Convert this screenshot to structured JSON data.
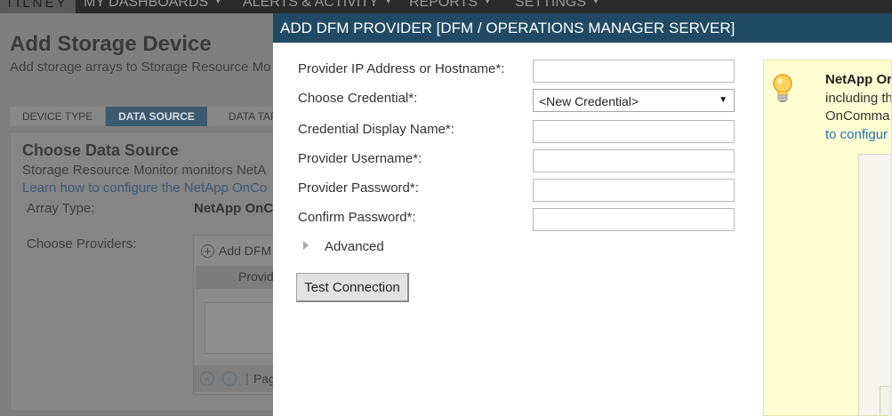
{
  "topnav": {
    "brand": "TILNEY",
    "items": [
      {
        "label": "MY DASHBOARDS"
      },
      {
        "label": "ALERTS & ACTIVITY"
      },
      {
        "label": "REPORTS"
      },
      {
        "label": "SETTINGS"
      }
    ]
  },
  "page": {
    "title": "Add Storage Device",
    "subtitle": "Add storage arrays to Storage Resource Mo",
    "steps": [
      "DEVICE TYPE",
      "DATA SOURCE",
      "DATA TARG"
    ],
    "panel": {
      "title": "Choose Data Source",
      "description": "Storage Resource Monitor monitors NetA",
      "link": "Learn how to configure the NetApp OnCo",
      "array_type_label": "Array Type:",
      "array_type_value": "NetApp OnC",
      "providers_label": "Choose Providers:",
      "add_provider": "Add DFM",
      "provider_column": "Provid",
      "pager_text": "Pag"
    }
  },
  "modal": {
    "title": "ADD DFM PROVIDER [DFM / OPERATIONS MANAGER SERVER]",
    "fields": {
      "ip_label": "Provider IP Address or Hostname*:",
      "ip_value": "",
      "credential_label": "Choose Credential*:",
      "credential_value": "<New Credential>",
      "display_name_label": "Credential Display Name*:",
      "display_name_value": "",
      "username_label": "Provider Username*:",
      "username_value": "",
      "password_label": "Provider Password*:",
      "password_value": "",
      "confirm_label": "Confirm Password*:",
      "confirm_value": ""
    },
    "advanced_label": "Advanced",
    "test_button": "Test Connection",
    "help": {
      "title": "NetApp Or",
      "line1": "including th",
      "line2": "OnComma",
      "link": "to configur"
    }
  },
  "colors": {
    "modal_header": "#204a64",
    "help_background": "#fffed2",
    "link": "#2a6fb0",
    "active_step": "#3b5a70"
  }
}
